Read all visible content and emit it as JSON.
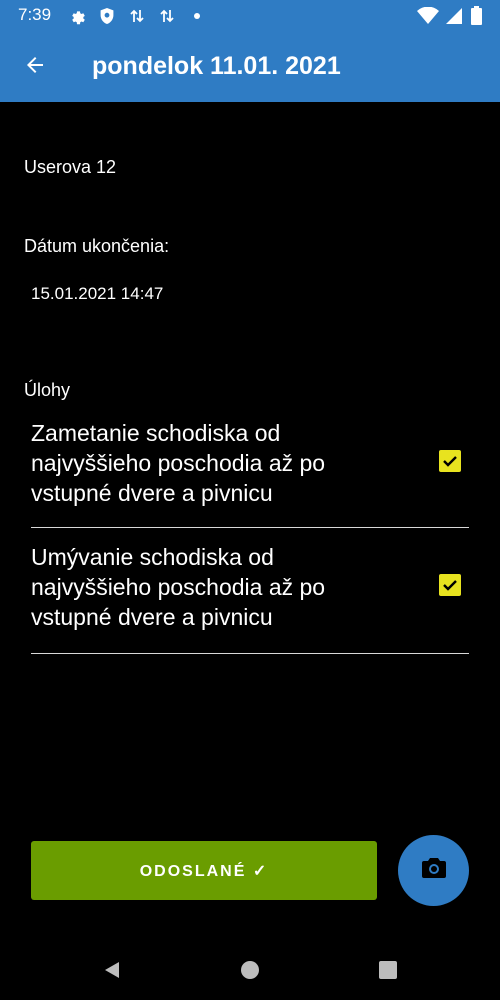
{
  "status_bar": {
    "time": "7:39",
    "icons": [
      "gear-icon",
      "shield-icon",
      "data-sync-icon",
      "data-sync-icon",
      "dot-icon"
    ],
    "right_icons": [
      "wifi-icon",
      "signal-icon",
      "battery-icon"
    ]
  },
  "app_bar": {
    "title": "pondelok 11.01. 2021",
    "back_icon": "arrow-left-icon"
  },
  "content": {
    "user": "Userova 12",
    "end_date_label": "Dátum ukončenia:",
    "end_date_value": "15.01.2021 14:47",
    "tasks_label": "Úlohy",
    "tasks": [
      {
        "text": "Zametanie schodiska od najvyššieho poschodia až po vstupné dvere a pivnicu",
        "checked": true
      },
      {
        "text": "Umývanie schodiska od najvyššieho poschodia až po vstupné dvere a pivnicu",
        "checked": true
      }
    ]
  },
  "actions": {
    "send_label": "ODOSLANÉ ✓",
    "camera_icon": "camera-icon"
  },
  "colors": {
    "primary": "#2f7cc4",
    "accent_green": "#6a9d00",
    "checkbox_yellow": "#e8e31f",
    "background": "#000000"
  }
}
